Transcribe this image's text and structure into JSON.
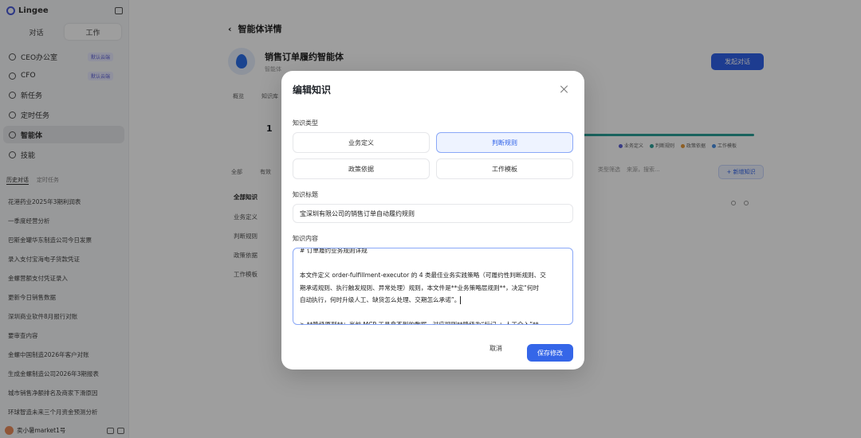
{
  "sidebar": {
    "brand": "Lingee",
    "modes": [
      "对话",
      "工作"
    ],
    "nav": [
      {
        "label": "CEO办公室",
        "badge": "默认云端"
      },
      {
        "label": "CFO",
        "badge": "默认云端"
      },
      {
        "label": "新任务",
        "badge": ""
      },
      {
        "label": "定时任务",
        "badge": ""
      },
      {
        "label": "智能体",
        "badge": ""
      },
      {
        "label": "技能",
        "badge": ""
      }
    ],
    "history_tabs": [
      "历史对话",
      "定时任务"
    ],
    "history": [
      "花港药业2025年3期利润表",
      "一季度经营分析",
      "巴斯金罐华东制造公司今日发票",
      "录入支付宝海电子货款凭证",
      "金螺营额支付凭证录入",
      "更新今日销售数据",
      "深圳商业软件8月报行对账",
      "要审查内容",
      "金螺中国制造2026年客户对账",
      "生成金螺制造公司2026年3期报表",
      "城市销售净额排名及商家下滑原因",
      "环球智造未来三个月资金预测分析"
    ],
    "user": "卖小暑market1号"
  },
  "page": {
    "header": "智能体详情",
    "agent_name": "销售订单履约智能体",
    "agent_sub": "智能体",
    "try_button": "发起对话",
    "tabs": [
      "概览",
      "知识库"
    ],
    "stat": "1",
    "legend": [
      "业务定义",
      "判断规则",
      "政策依据",
      "工作模板"
    ],
    "content_tabs": [
      "全部",
      "有效"
    ],
    "filters": [
      "类型筛选",
      "来源，搜索..."
    ],
    "add_button": "+ 新增知识",
    "categories": [
      "全部知识",
      "业务定义",
      "判断规则",
      "政策依据",
      "工作模板"
    ]
  },
  "modal": {
    "title": "编辑知识",
    "type_label": "知识类型",
    "types": [
      "业务定义",
      "判断规则",
      "政策依据",
      "工作模板"
    ],
    "selected_type": "判断规则",
    "title_label": "知识标题",
    "title_value": "宝深圳有限公司的销售订单自动履约规则",
    "content_label": "知识内容",
    "content_lines": [
      "# 订单履约业务规则详规",
      "",
      "本文件定义 order-fulfillment-executor 的 4 类最佳业务实践策略（可履约性判断规则、交",
      "期承诺规则、执行触发规则、异常处理）规则，本文件是**业务策略层规则**，决定“何时",
      "自动执行，何时升级人工、缺货怎么处理、交期怎么承诺”。",
      "",
      "> **降级原则**：当前 MCP 工具拿不到的数据，对应规则**降级为“标记 + 人工介入”**——"
    ],
    "cancel": "取消",
    "save": "保存修改"
  },
  "colors": {
    "accent": "#3566e8",
    "selected_border": "#8aa8f7",
    "selected_bg": "#eef3ff"
  }
}
